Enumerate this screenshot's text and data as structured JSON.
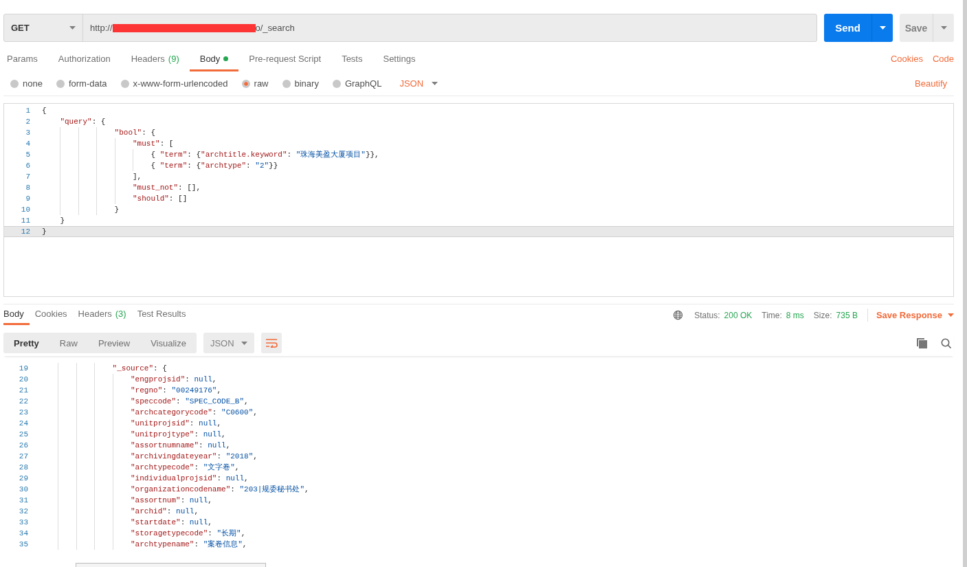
{
  "request_bar": {
    "method": "GET",
    "url_prefix": "http://",
    "url_suffix": "o/_search",
    "send": "Send",
    "save": "Save"
  },
  "request_tabs": [
    {
      "label": "Params",
      "selected": false
    },
    {
      "label": "Authorization",
      "selected": false
    },
    {
      "label": "Headers",
      "count": "(9)",
      "selected": false
    },
    {
      "label": "Body",
      "dot": true,
      "selected": true
    },
    {
      "label": "Pre-request Script",
      "selected": false
    },
    {
      "label": "Tests",
      "selected": false
    },
    {
      "label": "Settings",
      "selected": false
    }
  ],
  "request_links": [
    "Cookies",
    "Code"
  ],
  "body_types": [
    {
      "label": "none",
      "selected": false
    },
    {
      "label": "form-data",
      "selected": false
    },
    {
      "label": "x-www-form-urlencoded",
      "selected": false
    },
    {
      "label": "raw",
      "selected": true
    },
    {
      "label": "binary",
      "selected": false
    },
    {
      "label": "GraphQL",
      "selected": false
    }
  ],
  "body_format": "JSON",
  "beautify": "Beautify",
  "request_body": {
    "lines": [
      {
        "number": "1",
        "active": false,
        "tokens": [
          {
            "kind": "punct",
            "text": "{"
          }
        ]
      },
      {
        "number": "2",
        "active": false,
        "tokens": [
          {
            "kind": "key",
            "text": "    \"query\""
          },
          {
            "kind": "punct",
            "text": ": {"
          }
        ]
      },
      {
        "number": "3",
        "active": false,
        "tokens": [
          {
            "kind": "key",
            "text": "                \"bool\""
          },
          {
            "kind": "punct",
            "text": ": {"
          }
        ]
      },
      {
        "number": "4",
        "active": false,
        "tokens": [
          {
            "kind": "key",
            "text": "                    \"must\""
          },
          {
            "kind": "punct",
            "text": ": ["
          }
        ]
      },
      {
        "number": "5",
        "active": false,
        "tokens": [
          {
            "kind": "punct",
            "text": "                        { "
          },
          {
            "kind": "key",
            "text": "\"term\""
          },
          {
            "kind": "punct",
            "text": ": {"
          },
          {
            "kind": "key",
            "text": "\"archtitle.keyword\""
          },
          {
            "kind": "punct",
            "text": ": "
          },
          {
            "kind": "string",
            "text": "\"珠海美盈大厦项目\""
          },
          {
            "kind": "punct",
            "text": "}},"
          }
        ]
      },
      {
        "number": "6",
        "active": false,
        "tokens": [
          {
            "kind": "punct",
            "text": "                        { "
          },
          {
            "kind": "key",
            "text": "\"term\""
          },
          {
            "kind": "punct",
            "text": ": {"
          },
          {
            "kind": "key",
            "text": "\"archtype\""
          },
          {
            "kind": "punct",
            "text": ": "
          },
          {
            "kind": "string",
            "text": "\"2\""
          },
          {
            "kind": "punct",
            "text": "}}"
          }
        ]
      },
      {
        "number": "7",
        "active": false,
        "tokens": [
          {
            "kind": "punct",
            "text": "                    ],"
          }
        ]
      },
      {
        "number": "8",
        "active": false,
        "tokens": [
          {
            "kind": "key",
            "text": "                    \"must_not\""
          },
          {
            "kind": "punct",
            "text": ": [],"
          }
        ]
      },
      {
        "number": "9",
        "active": false,
        "tokens": [
          {
            "kind": "key",
            "text": "                    \"should\""
          },
          {
            "kind": "punct",
            "text": ": []"
          }
        ]
      },
      {
        "number": "10",
        "active": false,
        "tokens": [
          {
            "kind": "punct",
            "text": "                }"
          }
        ]
      },
      {
        "number": "11",
        "active": false,
        "tokens": [
          {
            "kind": "punct",
            "text": "    }"
          }
        ]
      },
      {
        "number": "12",
        "active": true,
        "tokens": [
          {
            "kind": "punct",
            "text": "}"
          }
        ]
      }
    ]
  },
  "response_tabs": [
    {
      "label": "Body",
      "selected": true
    },
    {
      "label": "Cookies",
      "selected": false
    },
    {
      "label": "Headers",
      "count": "(3)",
      "selected": false
    },
    {
      "label": "Test Results",
      "selected": false
    }
  ],
  "response_meta": {
    "status_label": "Status:",
    "status": "200 OK",
    "time_label": "Time:",
    "time": "8 ms",
    "size_label": "Size:",
    "size": "735 B",
    "save_response": "Save Response"
  },
  "view_modes": [
    {
      "label": "Pretty",
      "selected": true
    },
    {
      "label": "Raw",
      "selected": false
    },
    {
      "label": "Preview",
      "selected": false
    },
    {
      "label": "Visualize",
      "selected": false
    }
  ],
  "response_format": "JSON",
  "response_body": {
    "lines": [
      {
        "number": "19",
        "tokens": [
          {
            "kind": "key",
            "text": "                \"_source\""
          },
          {
            "kind": "punct",
            "text": ": {"
          }
        ]
      },
      {
        "number": "20",
        "tokens": [
          {
            "kind": "key",
            "text": "                    \"engprojsid\""
          },
          {
            "kind": "punct",
            "text": ": "
          },
          {
            "kind": "null",
            "text": "null"
          },
          {
            "kind": "punct",
            "text": ","
          }
        ]
      },
      {
        "number": "21",
        "tokens": [
          {
            "kind": "key",
            "text": "                    \"regno\""
          },
          {
            "kind": "punct",
            "text": ": "
          },
          {
            "kind": "string",
            "text": "\"00249176\""
          },
          {
            "kind": "punct",
            "text": ","
          }
        ]
      },
      {
        "number": "22",
        "tokens": [
          {
            "kind": "key",
            "text": "                    \"speccode\""
          },
          {
            "kind": "punct",
            "text": ": "
          },
          {
            "kind": "string",
            "text": "\"SPEC_CODE_B\""
          },
          {
            "kind": "punct",
            "text": ","
          }
        ]
      },
      {
        "number": "23",
        "tokens": [
          {
            "kind": "key",
            "text": "                    \"archcategorycode\""
          },
          {
            "kind": "punct",
            "text": ": "
          },
          {
            "kind": "string",
            "text": "\"C0600\""
          },
          {
            "kind": "punct",
            "text": ","
          }
        ]
      },
      {
        "number": "24",
        "tokens": [
          {
            "kind": "key",
            "text": "                    \"unitprojsid\""
          },
          {
            "kind": "punct",
            "text": ": "
          },
          {
            "kind": "null",
            "text": "null"
          },
          {
            "kind": "punct",
            "text": ","
          }
        ]
      },
      {
        "number": "25",
        "tokens": [
          {
            "kind": "key",
            "text": "                    \"unitprojtype\""
          },
          {
            "kind": "punct",
            "text": ": "
          },
          {
            "kind": "null",
            "text": "null"
          },
          {
            "kind": "punct",
            "text": ","
          }
        ]
      },
      {
        "number": "26",
        "tokens": [
          {
            "kind": "key",
            "text": "                    \"assortnumname\""
          },
          {
            "kind": "punct",
            "text": ": "
          },
          {
            "kind": "null",
            "text": "null"
          },
          {
            "kind": "punct",
            "text": ","
          }
        ]
      },
      {
        "number": "27",
        "tokens": [
          {
            "kind": "key",
            "text": "                    \"archivingdateyear\""
          },
          {
            "kind": "punct",
            "text": ": "
          },
          {
            "kind": "string",
            "text": "\"2018\""
          },
          {
            "kind": "punct",
            "text": ","
          }
        ]
      },
      {
        "number": "28",
        "tokens": [
          {
            "kind": "key",
            "text": "                    \"archtypecode\""
          },
          {
            "kind": "punct",
            "text": ": "
          },
          {
            "kind": "string",
            "text": "\"文字卷\""
          },
          {
            "kind": "punct",
            "text": ","
          }
        ]
      },
      {
        "number": "29",
        "tokens": [
          {
            "kind": "key",
            "text": "                    \"individualprojsid\""
          },
          {
            "kind": "punct",
            "text": ": "
          },
          {
            "kind": "null",
            "text": "null"
          },
          {
            "kind": "punct",
            "text": ","
          }
        ]
      },
      {
        "number": "30",
        "tokens": [
          {
            "kind": "key",
            "text": "                    \"organizationcodename\""
          },
          {
            "kind": "punct",
            "text": ": "
          },
          {
            "kind": "string",
            "text": "\"203|规委秘书处\""
          },
          {
            "kind": "punct",
            "text": ","
          }
        ]
      },
      {
        "number": "31",
        "tokens": [
          {
            "kind": "key",
            "text": "                    \"assortnum\""
          },
          {
            "kind": "punct",
            "text": ": "
          },
          {
            "kind": "null",
            "text": "null"
          },
          {
            "kind": "punct",
            "text": ","
          }
        ]
      },
      {
        "number": "32",
        "tokens": [
          {
            "kind": "key",
            "text": "                    \"archid\""
          },
          {
            "kind": "punct",
            "text": ": "
          },
          {
            "kind": "null",
            "text": "null"
          },
          {
            "kind": "punct",
            "text": ","
          }
        ]
      },
      {
        "number": "33",
        "tokens": [
          {
            "kind": "key",
            "text": "                    \"startdate\""
          },
          {
            "kind": "punct",
            "text": ": "
          },
          {
            "kind": "null",
            "text": "null"
          },
          {
            "kind": "punct",
            "text": ","
          }
        ]
      },
      {
        "number": "34",
        "tokens": [
          {
            "kind": "key",
            "text": "                    \"storagetypecode\""
          },
          {
            "kind": "punct",
            "text": ": "
          },
          {
            "kind": "string",
            "text": "\"长期\""
          },
          {
            "kind": "punct",
            "text": ","
          }
        ]
      },
      {
        "number": "35",
        "tokens": [
          {
            "kind": "key",
            "text": "                    \"archtypename\""
          },
          {
            "kind": "punct",
            "text": ": "
          },
          {
            "kind": "string",
            "text": "\"案卷信息\""
          },
          {
            "kind": "punct",
            "text": ","
          }
        ]
      }
    ]
  }
}
